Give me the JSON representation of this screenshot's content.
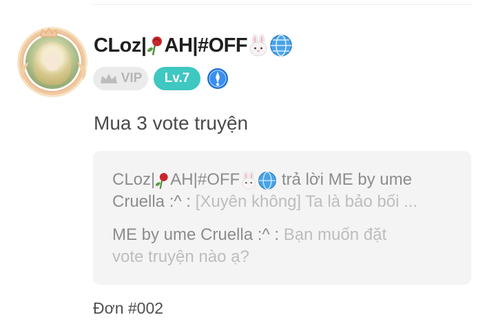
{
  "post": {
    "username_parts": [
      "CLoz|",
      "AH|#OFF"
    ],
    "username_emojis": [
      "rose-icon",
      "rabbit-icon",
      "globe-icon"
    ],
    "badges": {
      "vip_label": "VIP",
      "level_label": "Lv.7",
      "medal_icon": "medal-icon"
    },
    "title": "Mua 3 vote truyện"
  },
  "quote": {
    "line1_name_parts": [
      "CLoz|",
      "AH|#OFF"
    ],
    "line1_action": "trả lời ME by ume",
    "line2_name": "Cruella :^ :",
    "line2_text": "[Xuyên không] Ta là bảo bối ...",
    "line3_name": "ME by ume Cruella :^ :",
    "line3_text": "Bạn muốn đặt",
    "line4_text": "vote truyện nào ạ?"
  },
  "footer": {
    "order_id": "Đơn #002"
  },
  "colors": {
    "level_badge": "#3fc7c1",
    "vip_badge_bg": "#ebebeb",
    "quote_bg": "#f4f4f4"
  }
}
